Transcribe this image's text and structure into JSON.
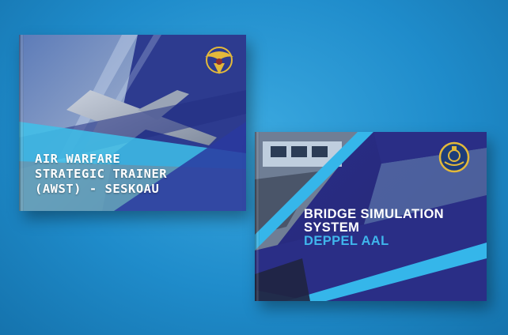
{
  "scene": {
    "background_color": "#2597d4"
  },
  "book_left": {
    "title_lines": [
      "AIR WARFARE",
      "STRATEGIC TRAINER",
      "(AWST) - SESKOAU"
    ],
    "accent_color": "#3ec1ea",
    "emblem_icon": "gold-wings-emblem"
  },
  "book_right": {
    "title_lines": [
      "BRIDGE SIMULATION",
      "SYSTEM"
    ],
    "subtitle": "DEPPEL AAL",
    "accent_color": "#35b6ea",
    "emblem_icon": "gold-navy-emblem"
  }
}
